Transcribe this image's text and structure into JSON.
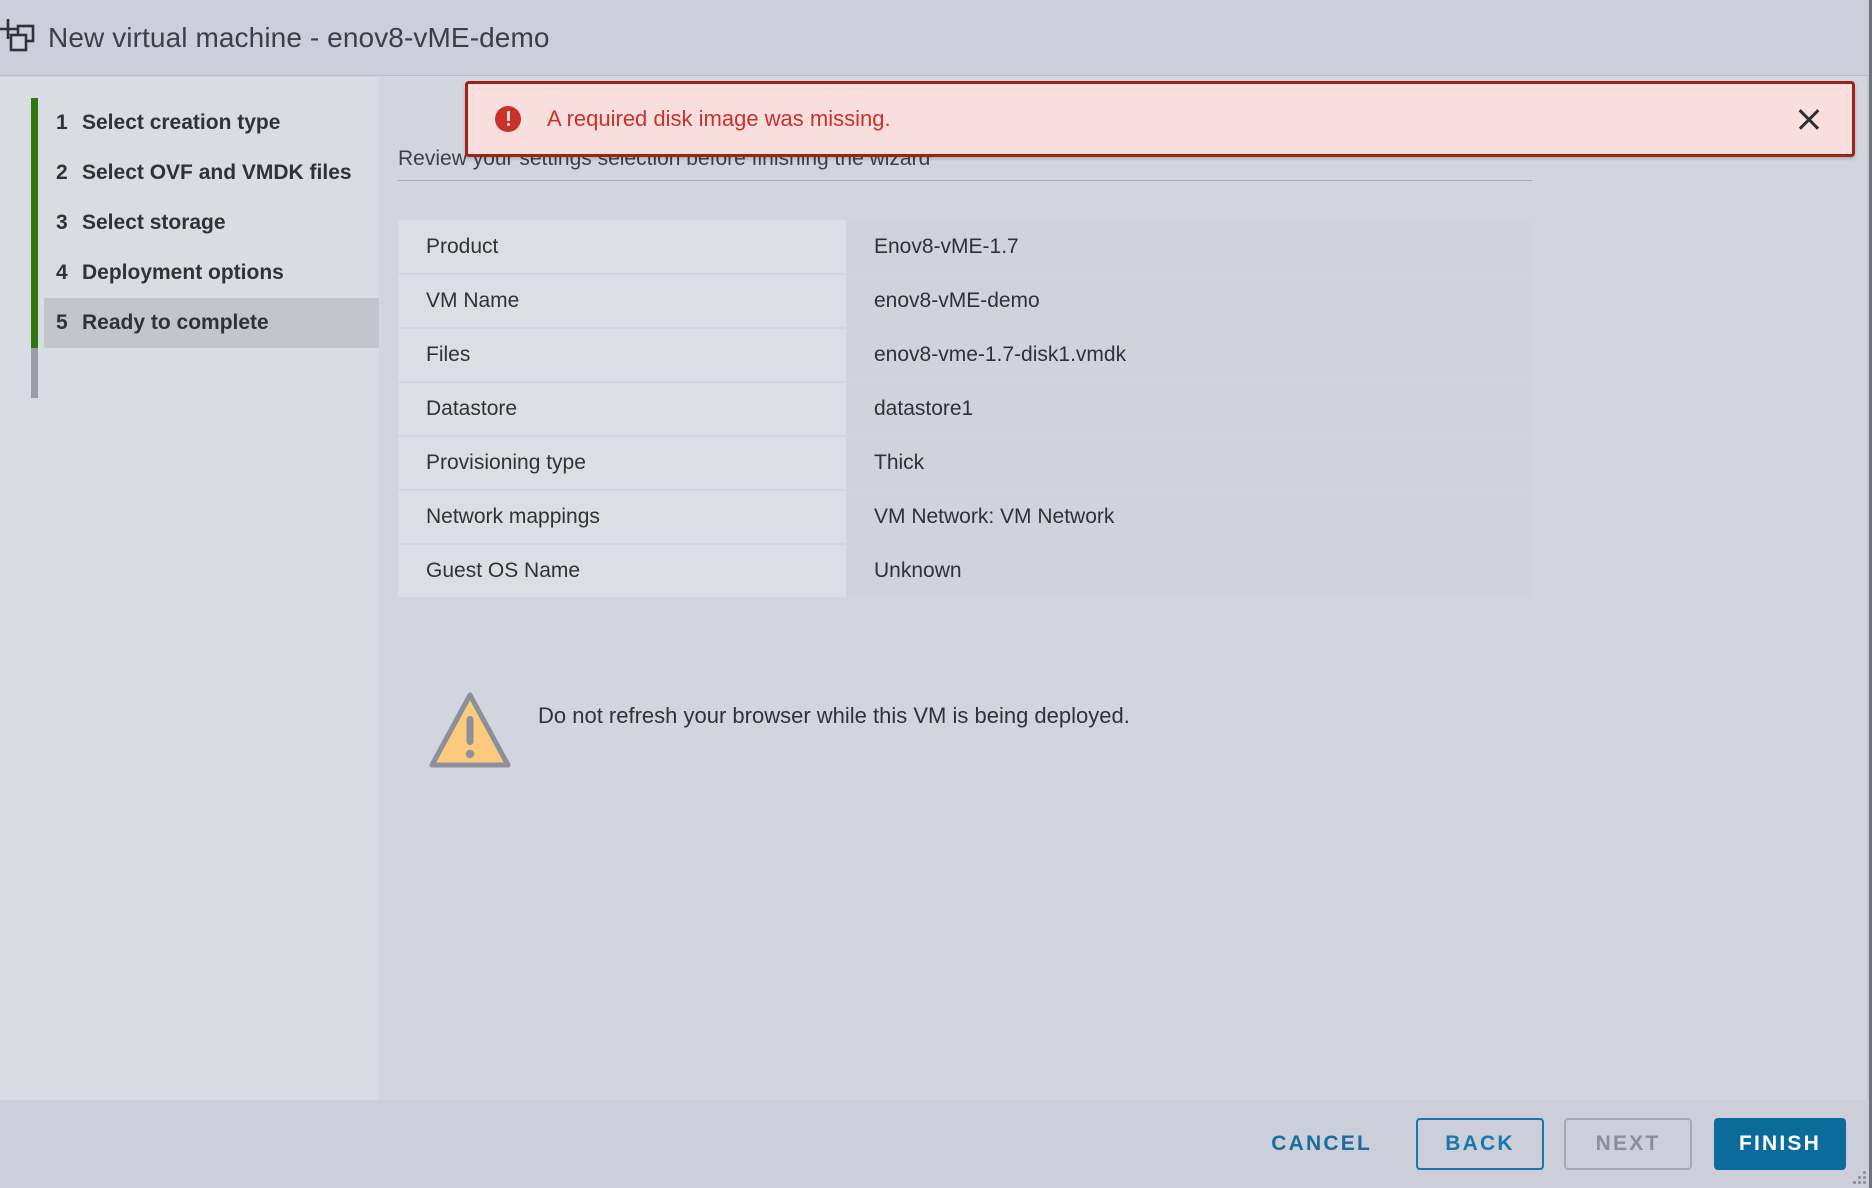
{
  "window": {
    "title": "New virtual machine - enov8-vME-demo",
    "title_icon": "new-virtual-machine-icon"
  },
  "sidebar": {
    "steps": [
      {
        "num": "1",
        "label": "Select creation type",
        "state": "done"
      },
      {
        "num": "2",
        "label": "Select OVF and VMDK files",
        "state": "done"
      },
      {
        "num": "3",
        "label": "Select storage",
        "state": "done"
      },
      {
        "num": "4",
        "label": "Deployment options",
        "state": "done"
      },
      {
        "num": "5",
        "label": "Ready to complete",
        "state": "current"
      }
    ]
  },
  "error": {
    "icon": "error-circle-icon",
    "message": "A required disk image was missing.",
    "close_icon": "close-icon",
    "color": "#c9322a",
    "background": "#f9dede",
    "border": "#9e2216"
  },
  "main": {
    "subtitle": "Review your settings selection before finishing the wizard",
    "summary": [
      {
        "key": "Product",
        "value": "Enov8-vME-1.7"
      },
      {
        "key": "VM Name",
        "value": "enov8-vME-demo"
      },
      {
        "key": "Files",
        "value": "enov8-vme-1.7-disk1.vmdk"
      },
      {
        "key": "Datastore",
        "value": "datastore1"
      },
      {
        "key": "Provisioning type",
        "value": "Thick"
      },
      {
        "key": "Network mappings",
        "value": "VM Network: VM Network"
      },
      {
        "key": "Guest OS Name",
        "value": "Unknown"
      }
    ],
    "warning": {
      "icon": "warning-triangle-icon",
      "text": "Do not refresh your browser while this VM is being deployed."
    }
  },
  "footer": {
    "cancel_label": "CANCEL",
    "back_label": "BACK",
    "next_label": "NEXT",
    "finish_label": "FINISH",
    "accent_color": "#0b6c9c",
    "disabled_color": "#8b8e98"
  }
}
